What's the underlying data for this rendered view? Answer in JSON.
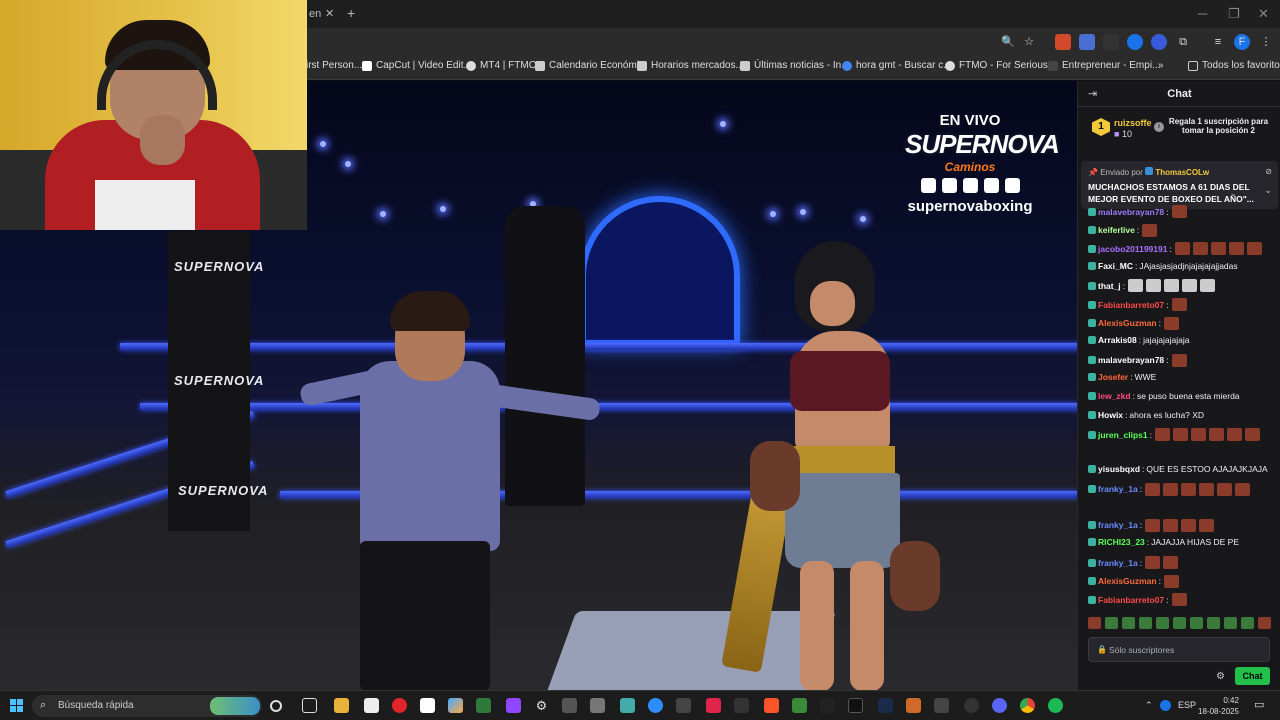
{
  "browser": {
    "tab_fragment": "en",
    "new_tab": "+",
    "bookmarks": [
      {
        "label": "irst Person...",
        "color": "#888888"
      },
      {
        "label": "CapCut | Video Edit...",
        "color": "#ffffff"
      },
      {
        "label": "MT4 | FTMO",
        "color": "#dddddd"
      },
      {
        "label": "Calendario Económi...",
        "color": "#cccccc"
      },
      {
        "label": "Horarios mercados...",
        "color": "#cccccc"
      },
      {
        "label": "Últimas noticias - In...",
        "color": "#cccccc"
      },
      {
        "label": "hora gmt - Buscar c...",
        "color": "#4285f4"
      },
      {
        "label": "FTMO - For Serious...",
        "color": "#dddddd"
      },
      {
        "label": "Entrepreneur - Empi...",
        "color": "#dddddd"
      }
    ],
    "bookmarks_more": "»",
    "all_bookmarks": "Todos los favoritos"
  },
  "stream": {
    "en_vivo": "EN VIVO",
    "brand": "SUPERNOVA",
    "sponsor": "Caminos",
    "handle": "supernovaboxing",
    "post_logo": "SUPERNOVA"
  },
  "chat": {
    "title": "Chat",
    "gift": {
      "rank": "1",
      "user": "ruizsoffe",
      "count": "10",
      "cta": "Regala 1 suscripción para tomar la posición 2"
    },
    "pinned": {
      "by_label": "Enviado por",
      "user": "ThomasCOLw",
      "text": "MUCHACHOS ESTAMOS A 61 DIAS DEL MEJOR EVENTO DE BOXEO DEL AÑO\"..."
    },
    "messages": [
      {
        "user": "malavebrayan78",
        "color": "#9b7bff",
        "text": "",
        "emotes": 1
      },
      {
        "user": "keiferlive",
        "color": "#b3ff9b",
        "text": "",
        "emotes": 1
      },
      {
        "user": "jacobo201199191",
        "color": "#a970ff",
        "text": "",
        "emotes": 5
      },
      {
        "user": "Faxi_MC",
        "color": "#ffffff",
        "text": "JAjasjasjadjnjajajajajjadas",
        "emotes": 0
      },
      {
        "user": "that_j",
        "color": "#ffffff",
        "text": "",
        "emotes": 5
      },
      {
        "user": "Fabianbarreto07",
        "color": "#ff4a4a",
        "text": "",
        "emotes": 1
      },
      {
        "user": "AlexisGuzman",
        "color": "#ff6a3a",
        "text": "",
        "emotes": 1
      },
      {
        "user": "Arrakis08",
        "color": "#ffffff",
        "text": "jajajajajajaja",
        "emotes": 0
      },
      {
        "user": "malavebrayan78",
        "color": "#ffffff",
        "text": "",
        "emotes": 1
      },
      {
        "user": "Josefer",
        "color": "#ff6a3a",
        "text": "WWE",
        "emotes": 0
      },
      {
        "user": "lew_zkd",
        "color": "#ff4a7a",
        "text": "se puso buena esta mierda",
        "emotes": 0
      },
      {
        "user": "Howix",
        "color": "#ffffff",
        "text": "ahora es lucha? XD",
        "emotes": 0
      },
      {
        "user": "juren_clips1",
        "color": "#5aff5a",
        "text": "",
        "emotes": 11
      },
      {
        "user": "yisusbqxd",
        "color": "#ffffff",
        "text": "QUE ES ESTOO AJAJAJKJAJA",
        "emotes": 0
      },
      {
        "user": "franky_1a",
        "color": "#6a8aff",
        "text": "",
        "emotes": 7
      },
      {
        "user": "franky_1a",
        "color": "#6a8aff",
        "text": "",
        "emotes": 4
      },
      {
        "user": "RICHI23_23",
        "color": "#5aff5a",
        "text": "JAJAJJA HIJAS DE PE",
        "emotes": 0
      },
      {
        "user": "franky_1a",
        "color": "#6a8aff",
        "text": "",
        "emotes": 2
      },
      {
        "user": "AlexisGuzman",
        "color": "#ff6a3a",
        "text": "",
        "emotes": 1
      },
      {
        "user": "Fabianbarreto07",
        "color": "#ff4a4a",
        "text": "",
        "emotes": 1
      }
    ],
    "input_placeholder": "Sólo suscriptores",
    "send_label": "Chat"
  },
  "taskbar": {
    "search_placeholder": "Búsqueda rápida",
    "lang": "ESP",
    "time": "0:42",
    "date": "18-08-2025"
  }
}
